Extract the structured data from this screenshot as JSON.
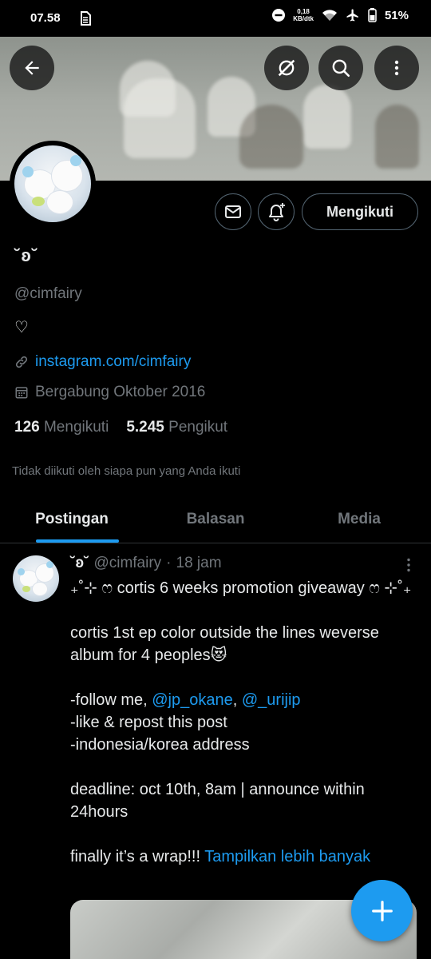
{
  "status_bar": {
    "time": "07.58",
    "net_speed_value": "0,18",
    "net_speed_unit": "KB/dtk",
    "battery": "51%"
  },
  "profile": {
    "display_name": "˘ʚ˘",
    "handle": "@cimfairy",
    "bio": "♡",
    "link": "instagram.com/cimfairy",
    "joined": "Bergabung Oktober 2016",
    "following_count": "126",
    "following_label": "Mengikuti",
    "followers_count": "5.245",
    "followers_label": "Pengikut",
    "follow_button": "Mengikuti",
    "not_followed_text": "Tidak diikuti oleh siapa pun yang Anda ikuti"
  },
  "tabs": [
    {
      "label": "Postingan",
      "active": true
    },
    {
      "label": "Balasan",
      "active": false
    },
    {
      "label": "Media",
      "active": false
    }
  ],
  "post": {
    "author_name": "˘ʚ˘",
    "author_handle": "@cimfairy",
    "separator": "·",
    "time": "18 jam",
    "line1": "₊˚⊹ ෆ cortis 6 weeks promotion giveaway ෆ ⊹˚₊",
    "line2": "cortis 1st ep color outside the lines weverse album for 4 peoples😻",
    "line3_prefix": "-follow me, ",
    "mention1": "@jp_okane",
    "comma": ", ",
    "mention2": "@_urijip",
    "line4": "-like & repost this post",
    "line5": "-indonesia/korea address",
    "line6": "deadline: oct 10th, 8am | announce within 24hours",
    "line7": "finally it’s a wrap!!! ",
    "show_more": "Tampilkan lebih banyak"
  },
  "colors": {
    "accent": "#1d9bf0",
    "background": "#000000",
    "muted": "#71767b",
    "text": "#e7e9ea"
  }
}
